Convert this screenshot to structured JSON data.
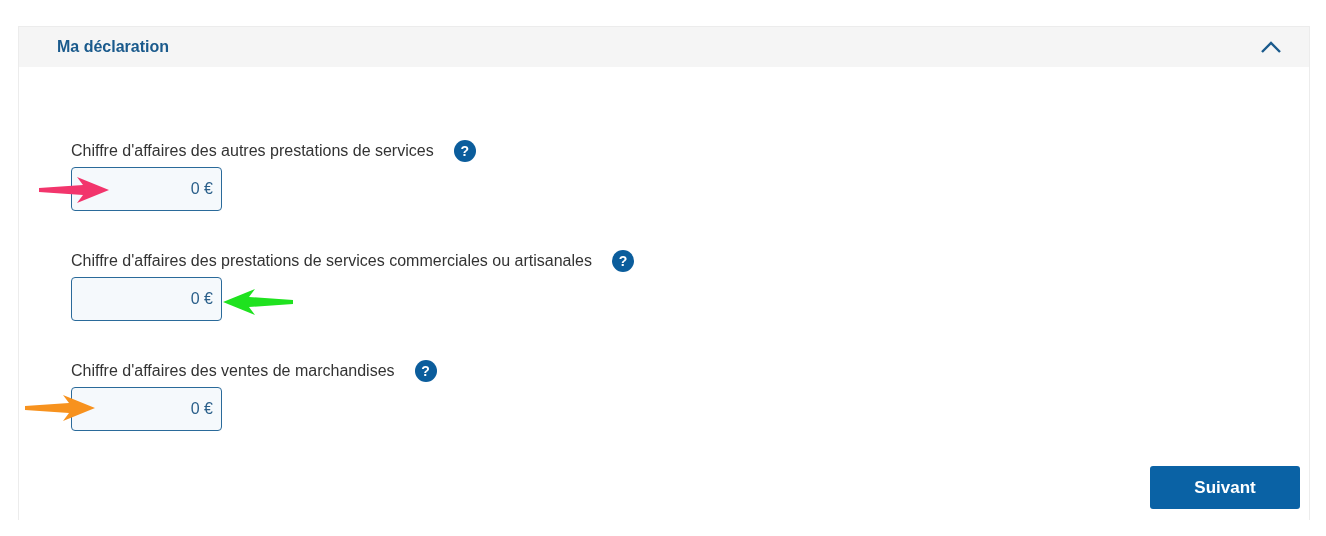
{
  "section": {
    "title": "Ma déclaration",
    "expanded": true
  },
  "fields": [
    {
      "label": "Chiffre d'affaires des autres prestations de services",
      "help": "?",
      "value": "0 €",
      "annotation": {
        "color": "#f2356c",
        "kind": "right"
      }
    },
    {
      "label": "Chiffre d'affaires des prestations de services commerciales ou artisanales",
      "help": "?",
      "value": "0 €",
      "annotation": {
        "color": "#1fe21f",
        "kind": "left"
      }
    },
    {
      "label": "Chiffre d'affaires des ventes de marchandises",
      "help": "?",
      "value": "0 €",
      "annotation": {
        "color": "#f7921e",
        "kind": "right"
      }
    }
  ],
  "buttons": [
    {
      "label": "Suivant"
    }
  ]
}
